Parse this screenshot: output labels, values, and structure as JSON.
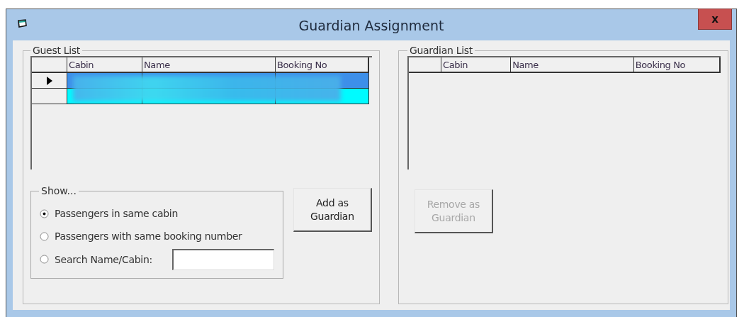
{
  "window": {
    "title": "Guardian Assignment",
    "close_label": "x"
  },
  "guest_list": {
    "title": "Guest List",
    "columns": [
      "Cabin",
      "Name",
      "Booking No"
    ],
    "rows": [
      {
        "selected": true,
        "color": "#3d8fe9"
      },
      {
        "selected": false,
        "color": "#00fbff"
      }
    ]
  },
  "show": {
    "title": "Show...",
    "options": [
      {
        "label": "Passengers in same cabin",
        "checked": true,
        "kind": "radio"
      },
      {
        "label": "Passengers with same booking number",
        "checked": false,
        "kind": "radio"
      },
      {
        "label": "Search Name/Cabin:",
        "checked": false,
        "kind": "search"
      }
    ]
  },
  "add_button": {
    "label": "Add as Guardian",
    "disabled": false
  },
  "guardian_list": {
    "title": "Guardian List",
    "columns": [
      "Cabin",
      "Name",
      "Booking No"
    ]
  },
  "remove_button": {
    "label": "Remove as Guardian",
    "disabled": true
  }
}
